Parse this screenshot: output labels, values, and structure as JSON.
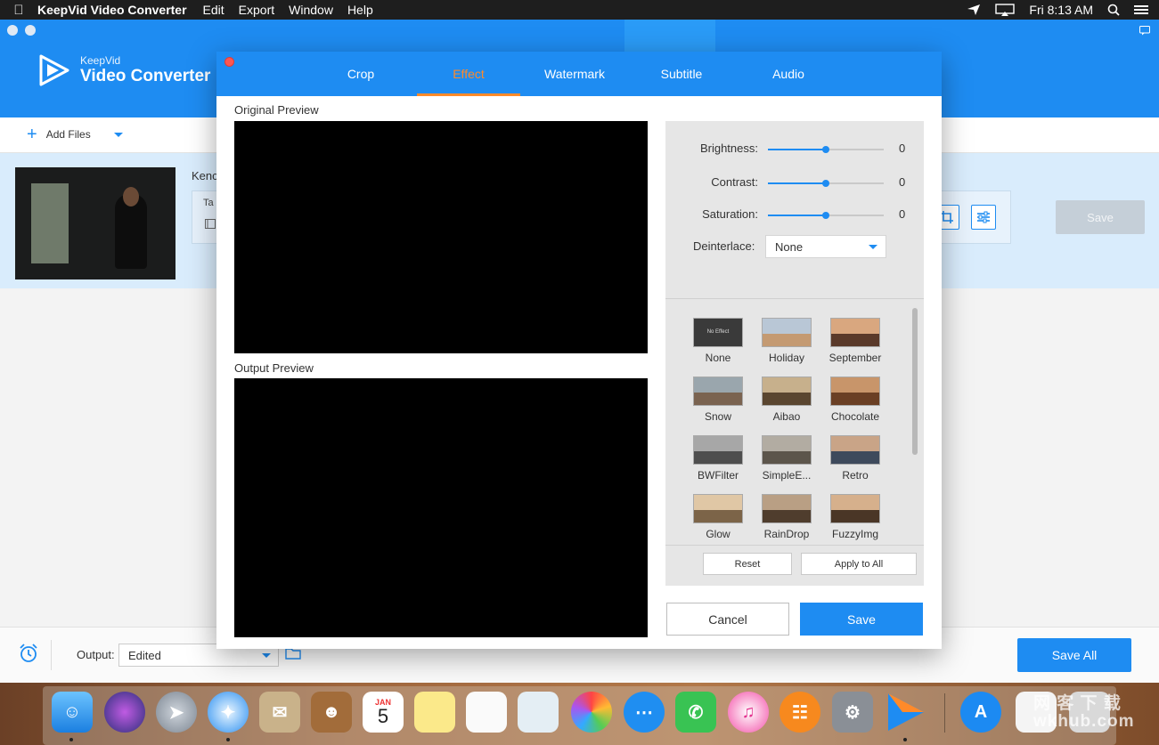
{
  "menubar": {
    "app_name": "KeepVid Video Converter",
    "items": [
      "Edit",
      "Export",
      "Window",
      "Help"
    ],
    "clock": "Fri 8:13 AM"
  },
  "app": {
    "brand_sub": "KeepVid",
    "brand_main": "Video Converter",
    "add_files_label": "Add Files",
    "file_name_partial": "Kenc",
    "target_label_partial": "Ta",
    "row_save_label": "Save",
    "output_label": "Output:",
    "output_value": "Edited",
    "save_all_label": "Save All",
    "accent_color": "#1e8cf2"
  },
  "dialog": {
    "tabs": [
      {
        "label": "Crop",
        "active": false
      },
      {
        "label": "Effect",
        "active": true
      },
      {
        "label": "Watermark",
        "active": false
      },
      {
        "label": "Subtitle",
        "active": false
      },
      {
        "label": "Audio",
        "active": false
      }
    ],
    "original_preview_label": "Original Preview",
    "output_preview_label": "Output Preview",
    "sliders": [
      {
        "label": "Brightness:",
        "value": "0",
        "level": 0.5
      },
      {
        "label": "Contrast:",
        "value": "0",
        "level": 0.5
      },
      {
        "label": "Saturation:",
        "value": "0",
        "level": 0.5
      }
    ],
    "deinterlace_label": "Deinterlace:",
    "deinterlace_value": "None",
    "filters": [
      {
        "label": "None",
        "no_effect_text": "No Effect"
      },
      {
        "label": "Holiday"
      },
      {
        "label": "September"
      },
      {
        "label": "Snow"
      },
      {
        "label": "Aibao"
      },
      {
        "label": "Chocolate"
      },
      {
        "label": "BWFilter"
      },
      {
        "label": "SimpleE..."
      },
      {
        "label": "Retro"
      },
      {
        "label": "Glow"
      },
      {
        "label": "RainDrop"
      },
      {
        "label": "FuzzyImg"
      }
    ],
    "reset_label": "Reset",
    "apply_all_label": "Apply to All",
    "cancel_label": "Cancel",
    "save_label": "Save",
    "active_tab_color": "#ff8a2a"
  },
  "dock": {
    "calendar_month": "JAN",
    "calendar_day": "5",
    "watermark_line1": "网 客 下 载",
    "watermark_line2": "wkhub.com"
  }
}
